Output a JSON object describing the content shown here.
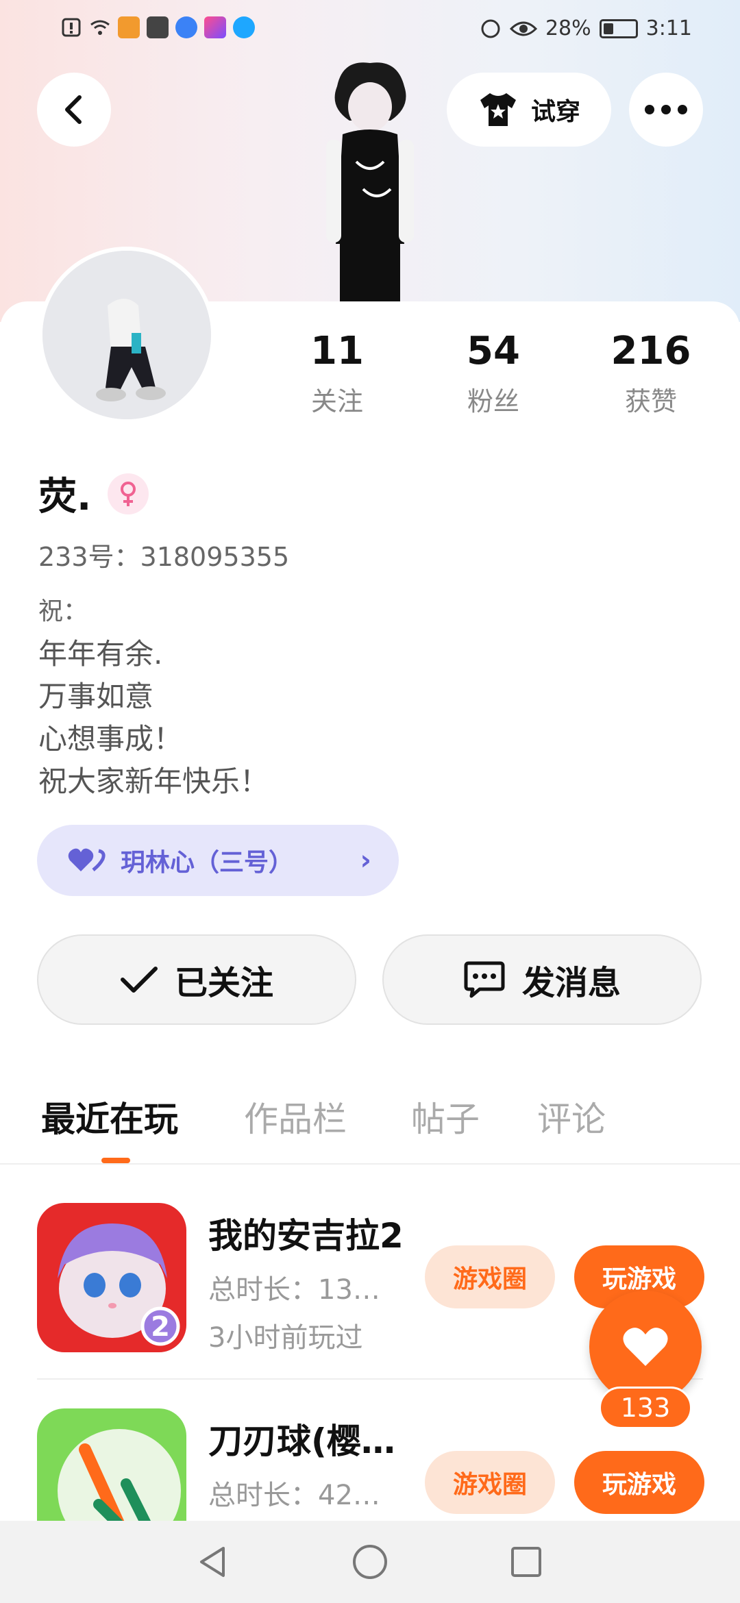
{
  "status_bar": {
    "battery": "28%",
    "time": "3:11"
  },
  "header": {
    "back_label": "‹",
    "tryon_label": "试穿",
    "more_label": "•••"
  },
  "profile": {
    "stats": [
      {
        "value": "11",
        "label": "关注"
      },
      {
        "value": "54",
        "label": "粉丝"
      },
      {
        "value": "216",
        "label": "获赞"
      }
    ],
    "name": "荧.",
    "gender": "female",
    "uid_line": "233号：318095355",
    "bio": [
      "祝：",
      "年年有余.",
      "万事如意",
      "心想事成！",
      "祝大家新年快乐！"
    ],
    "group_label": "玥林心（三号）"
  },
  "actions": {
    "follow_label": "已关注",
    "message_label": "发消息"
  },
  "tabs": [
    {
      "label": "最近在玩",
      "active": true
    },
    {
      "label": "作品栏",
      "active": false
    },
    {
      "label": "帖子",
      "active": false
    },
    {
      "label": "评论",
      "active": false
    }
  ],
  "games": [
    {
      "title": "我的安吉拉2",
      "time": "总时长：13…",
      "last_played": "3小时前玩过",
      "circle_label": "游戏圈",
      "play_label": "玩游戏"
    },
    {
      "title": "刀刃球(樱…",
      "time": "总时长：42…",
      "last_played": "",
      "circle_label": "游戏圈",
      "play_label": "玩游戏"
    }
  ],
  "fab": {
    "count": "133"
  },
  "colors": {
    "accent": "#ff6a1a",
    "group": "#6461d6",
    "group_bg": "#e6e6fb"
  }
}
